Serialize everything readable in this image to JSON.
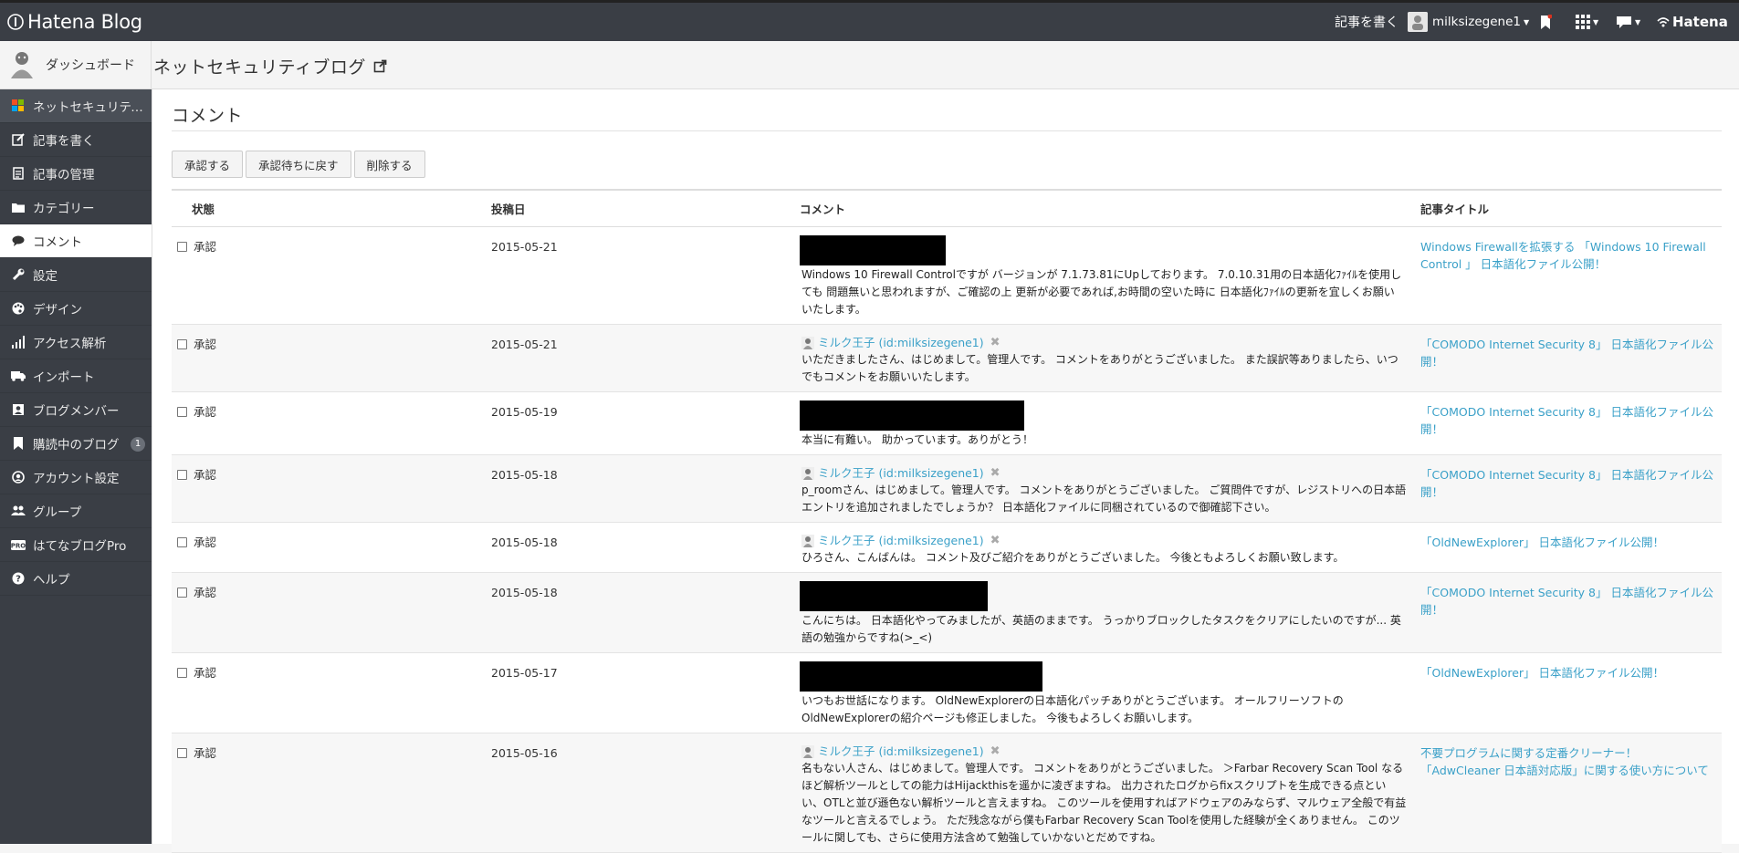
{
  "global_header": {
    "logo_text": "Hatena Blog",
    "write_label": "記事を書く",
    "username": "milksizegene1",
    "hatena_label": "Hatena"
  },
  "blog_header": {
    "dashboard_label": "ダッシュボード",
    "blog_title": "ネットセキュリティブログ"
  },
  "sidebar": {
    "items": [
      {
        "label": "ネットセキュリティブ...",
        "icon": "windows-icon"
      },
      {
        "label": "記事を書く",
        "icon": "edit-icon"
      },
      {
        "label": "記事の管理",
        "icon": "document-icon"
      },
      {
        "label": "カテゴリー",
        "icon": "folder-icon"
      },
      {
        "label": "コメント",
        "icon": "comment-icon"
      },
      {
        "label": "設定",
        "icon": "wrench-icon"
      },
      {
        "label": "デザイン",
        "icon": "palette-icon"
      },
      {
        "label": "アクセス解析",
        "icon": "bar-chart-icon"
      },
      {
        "label": "インポート",
        "icon": "truck-icon"
      },
      {
        "label": "ブログメンバー",
        "icon": "member-icon"
      },
      {
        "label": "購読中のブログ",
        "icon": "bookmark-icon",
        "badge": "1"
      },
      {
        "label": "アカウント設定",
        "icon": "user-circle-icon"
      },
      {
        "label": "グループ",
        "icon": "group-icon"
      },
      {
        "label": "はてなブログPro",
        "icon": "pro-icon"
      },
      {
        "label": "ヘルプ",
        "icon": "help-icon"
      }
    ]
  },
  "main": {
    "page_title": "コメント",
    "actions": {
      "approve": "承認する",
      "unapprove": "承認待ちに戻す",
      "delete": "削除する"
    },
    "columns": {
      "status": "状態",
      "date": "投稿日",
      "comment": "コメント",
      "article": "記事タイトル"
    },
    "rows": [
      {
        "status": "承認",
        "date": "2015-05-21",
        "author": "",
        "comment": "Windows 10 Firewall Controlですが バージョンが 7.1.73.81にUpしております。 7.0.10.31用の日本語化ﾌｧｲﾙを使用しても 問題無いと思われますが、ご確認の上 更新が必要であれば,お時間の空いた時に 日本語化ﾌｧｲﾙの更新を宜しくお願い いたします。",
        "article": "Windows Firewallを拡張する 「Windows 10 Firewall Control 」 日本語化ファイル公開！"
      },
      {
        "status": "承認",
        "date": "2015-05-21",
        "author": "ミルク王子 (id:milksizegene1)",
        "comment": "いただきましたさん、はじめまして。管理人です。 コメントをありがとうございました。 また誤訳等ありましたら、いつでもコメントをお願いいたします。",
        "article": "「COMODO Internet Security 8」 日本語化ファイル公開！"
      },
      {
        "status": "承認",
        "date": "2015-05-19",
        "author": "",
        "comment": "本当に有難い。 助かっています。ありがとう！",
        "article": "「COMODO Internet Security 8」 日本語化ファイル公開！"
      },
      {
        "status": "承認",
        "date": "2015-05-18",
        "author": "ミルク王子 (id:milksizegene1)",
        "comment": "p_roomさん、はじめまして。管理人です。 コメントをありがとうございました。 ご質問件ですが、レジストリへの日本語エントリを追加されましたでしょうか？ 日本語化ファイルに同梱されているので御確認下さい。",
        "article": "「COMODO Internet Security 8」 日本語化ファイル公開！"
      },
      {
        "status": "承認",
        "date": "2015-05-18",
        "author": "ミルク王子 (id:milksizegene1)",
        "comment": "ひろさん、こんばんは。 コメント及びご紹介をありがとうございました。 今後ともよろしくお願い致します。",
        "article": "「OldNewExplorer」 日本語化ファイル公開！"
      },
      {
        "status": "承認",
        "date": "2015-05-18",
        "author": "",
        "comment": "こんにちは。 日本語化やってみましたが、英語のままです。 うっかりブロックしたタスクをクリアにしたいのですが... 英語の勉強からですね(>_<)",
        "article": "「COMODO Internet Security 8」 日本語化ファイル公開！"
      },
      {
        "status": "承認",
        "date": "2015-05-17",
        "author": "",
        "comment": "いつもお世話になります。 OldNewExplorerの日本語化パッチありがとうございます。 オールフリーソフトのOldNewExplorerの紹介ページも修正しました。 今後もよろしくお願いします。",
        "article": "「OldNewExplorer」 日本語化ファイル公開！"
      },
      {
        "status": "承認",
        "date": "2015-05-16",
        "author": "ミルク王子 (id:milksizegene1)",
        "comment": "名もない人さん、はじめまして。管理人です。 コメントをありがとうございました。 ＞Farbar Recovery Scan Tool なるほど解析ツールとしての能力はHijackthisを遥かに凌ぎますね。 出力されたログからfixスクリプトを生成できる点といい、OTLと並び遜色ない解析ツールと言えますね。 このツールを使用すればアドウェアのみならず、マルウェア全般で有益なツールと言えるでしょう。 ただ残念ながら僕もFarbar Recovery Scan Toolを使用した経験が全くありません。 このツールに関しても、さらに使用方法含めて勉強していかないとだめですね。",
        "article": "不要プログラムに関する定番クリーナー！「AdwCleaner 日本語対応版」に関する使い方について"
      }
    ]
  }
}
